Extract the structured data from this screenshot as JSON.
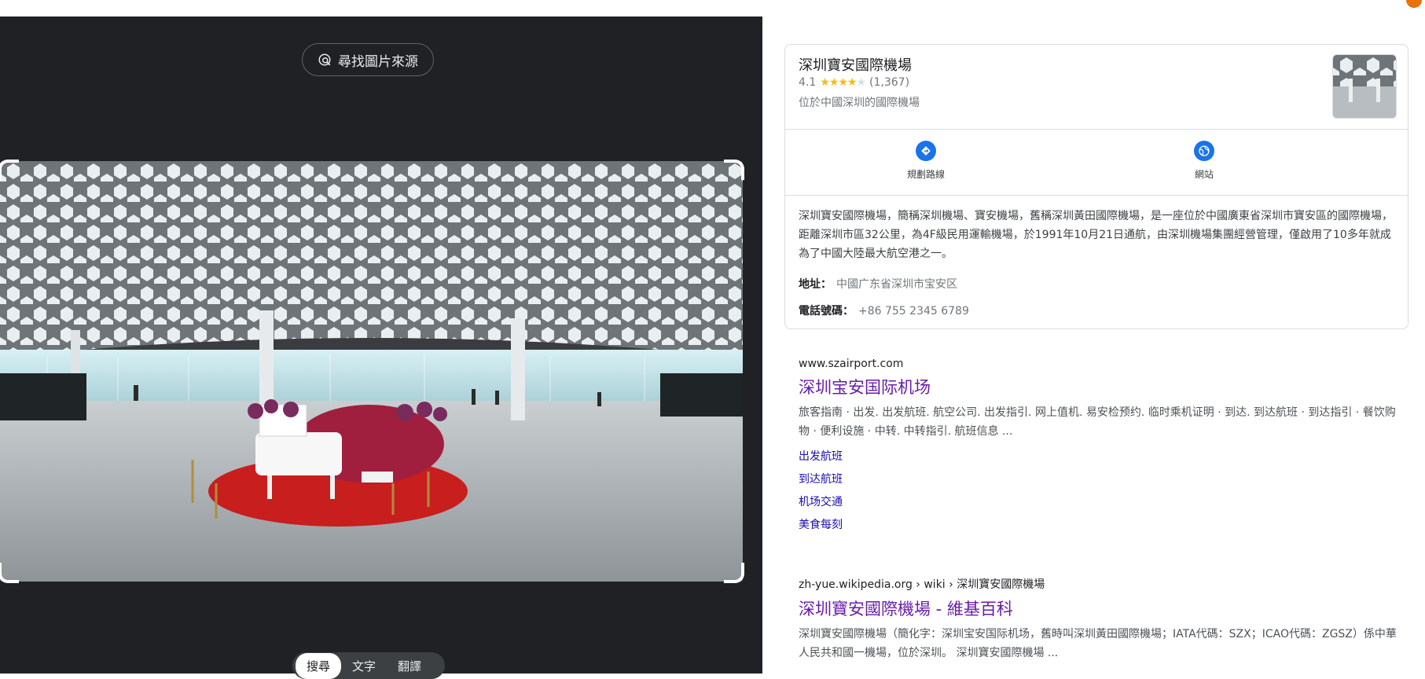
{
  "source_button": {
    "label": "尋找圖片來源",
    "icon": "lens-search-icon"
  },
  "mode_tabs": [
    {
      "label": "搜尋",
      "active": true
    },
    {
      "label": "文字",
      "active": false
    },
    {
      "label": "翻譯",
      "active": false
    }
  ],
  "knowledge_panel": {
    "title": "深圳寶安國際機場",
    "rating": "4.1",
    "rating_value": 4.1,
    "review_count": "(1,367)",
    "subtitle": "位於中國深圳的國際機場",
    "actions": [
      {
        "label": "規劃路線",
        "icon": "directions-icon"
      },
      {
        "label": "網站",
        "icon": "website-globe-icon"
      }
    ],
    "description": "深圳寶安國際機場，簡稱深圳機場、寶安機場，舊稱深圳黃田國際機場，是一座位於中國廣東省深圳市寶安區的國際機場，距離深圳市區32公里，為4F級民用運輸機場，於1991年10月21日通航，由深圳機場集團經營管理，僅啟用了10多年就成為了中國大陸最大航空港之一。",
    "address_label": "地址：",
    "address_value": "中國广东省深圳市宝安区",
    "phone_label": "電話號碼：",
    "phone_value": "+86 755 2345 6789"
  },
  "results": [
    {
      "url": "www.szairport.com",
      "title": "深圳宝安国际机场",
      "snippet": "旅客指南 · 出发. 出发航班. 航空公司. 出发指引. 网上值机. 易安检预约. 临时乘机证明 · 到达. 到达航班 · 到达指引 · 餐饮购物 · 便利设施 · 中转. 中转指引. 航班信息 ...",
      "sitelinks": [
        "出发航班",
        "到达航班",
        "机场交通",
        "美食每刻"
      ]
    },
    {
      "url": "zh-yue.wikipedia.org › wiki › 深圳寶安國際機場",
      "title": "深圳寶安國際機場 - 維基百科",
      "snippet": "深圳寶安國際機場（簡化字：深圳宝安国际机场，舊時叫深圳黃田國際機場；IATA代碼：SZX；ICAO代碼：ZGSZ）係中華人民共和國一機場，位於深圳。 深圳寶安國際機場 ..."
    }
  ],
  "colors": {
    "dark_bg": "#202124",
    "link_visited": "#681da8",
    "link": "#1a0dab",
    "accent_blue": "#1a73e8",
    "star": "#fbbc04"
  }
}
